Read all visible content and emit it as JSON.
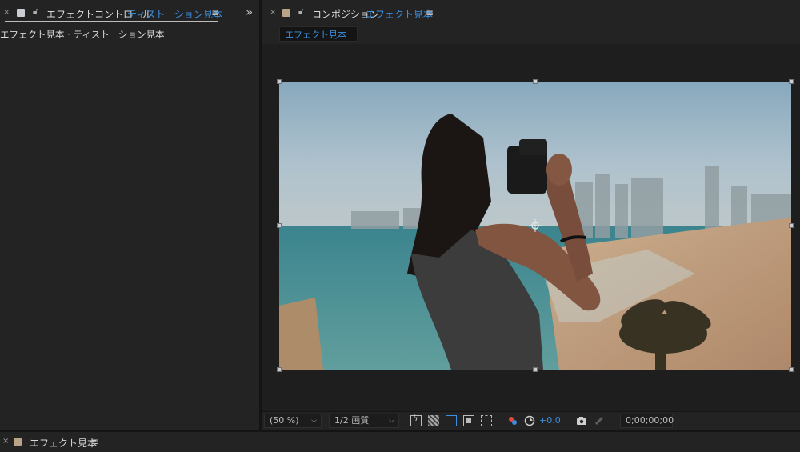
{
  "effect_controls": {
    "close": "×",
    "title": "エフェクトコントロール",
    "layer": "ティストーション見本",
    "menu": "≡",
    "expand": "»",
    "subtitle": "エフェクト見本 · ティストーション見本"
  },
  "composition": {
    "close": "×",
    "title": "コンポジション",
    "name": "エフェクト見本",
    "menu": "≡",
    "breadcrumb": "エフェクト見本"
  },
  "viewer_toolbar": {
    "zoom": "(50 %)",
    "resolution": "1/2 画質",
    "exposure": "+0.0",
    "timecode": "0;00;00;00"
  },
  "timeline": {
    "close": "×",
    "title": "エフェクト見本",
    "menu": "≡"
  },
  "colors": {
    "accent": "#3b8fe0",
    "panel": "#232323",
    "chip_left": "#c9ccd1",
    "chip_comp": "#b9a48a"
  }
}
